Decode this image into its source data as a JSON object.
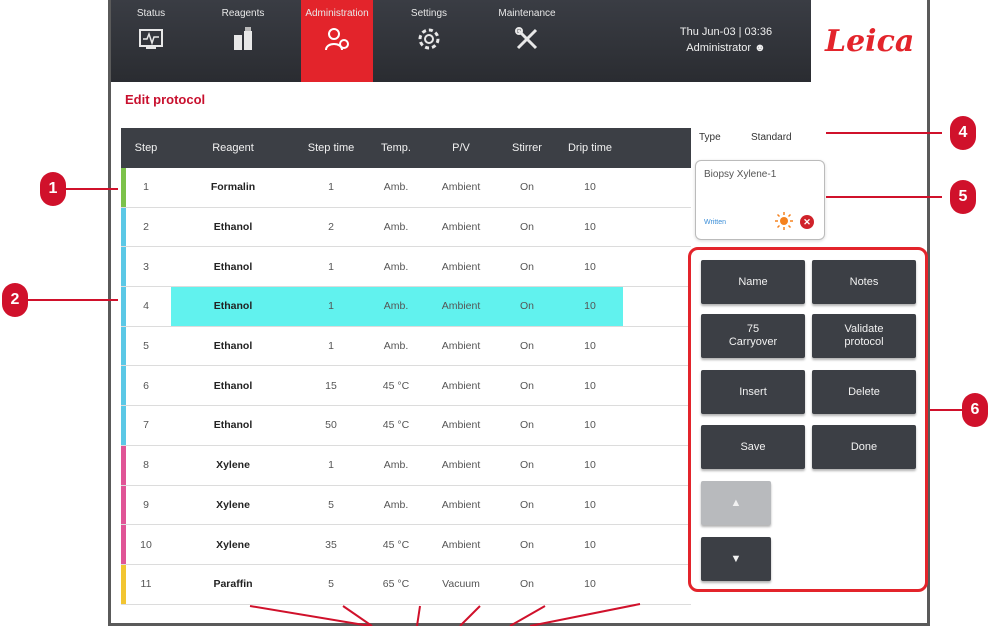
{
  "nav": {
    "tabs": [
      {
        "label": "Status",
        "icon": "status-monitor-icon"
      },
      {
        "label": "Reagents",
        "icon": "reagents-icon"
      },
      {
        "label": "Administration",
        "icon": "administration-icon"
      },
      {
        "label": "Settings",
        "icon": "settings-gear-icon"
      },
      {
        "label": "Maintenance",
        "icon": "maintenance-tools-icon"
      }
    ],
    "active_tab": "Administration",
    "datetime": "Thu Jun-03 | 03:36",
    "user": "Administrator",
    "logo": "Leica"
  },
  "page": {
    "title": "Edit protocol"
  },
  "table": {
    "headers": [
      "Step",
      "Reagent",
      "Step time",
      "Temp.",
      "P/V",
      "Stirrer",
      "Drip time"
    ],
    "rows": [
      {
        "step": "1",
        "reagent": "Formalin",
        "time": "1",
        "temp": "Amb.",
        "pv": "Ambient",
        "stirrer": "On",
        "drip": "10"
      },
      {
        "step": "2",
        "reagent": "Ethanol",
        "time": "2",
        "temp": "Amb.",
        "pv": "Ambient",
        "stirrer": "On",
        "drip": "10"
      },
      {
        "step": "3",
        "reagent": "Ethanol",
        "time": "1",
        "temp": "Amb.",
        "pv": "Ambient",
        "stirrer": "On",
        "drip": "10"
      },
      {
        "step": "4",
        "reagent": "Ethanol",
        "time": "1",
        "temp": "Amb.",
        "pv": "Ambient",
        "stirrer": "On",
        "drip": "10"
      },
      {
        "step": "5",
        "reagent": "Ethanol",
        "time": "1",
        "temp": "Amb.",
        "pv": "Ambient",
        "stirrer": "On",
        "drip": "10"
      },
      {
        "step": "6",
        "reagent": "Ethanol",
        "time": "15",
        "temp": "45 °C",
        "pv": "Ambient",
        "stirrer": "On",
        "drip": "10"
      },
      {
        "step": "7",
        "reagent": "Ethanol",
        "time": "50",
        "temp": "45 °C",
        "pv": "Ambient",
        "stirrer": "On",
        "drip": "10"
      },
      {
        "step": "8",
        "reagent": "Xylene",
        "time": "1",
        "temp": "Amb.",
        "pv": "Ambient",
        "stirrer": "On",
        "drip": "10"
      },
      {
        "step": "9",
        "reagent": "Xylene",
        "time": "5",
        "temp": "Amb.",
        "pv": "Ambient",
        "stirrer": "On",
        "drip": "10"
      },
      {
        "step": "10",
        "reagent": "Xylene",
        "time": "35",
        "temp": "45 °C",
        "pv": "Ambient",
        "stirrer": "On",
        "drip": "10"
      },
      {
        "step": "11",
        "reagent": "Paraffin",
        "time": "5",
        "temp": "65 °C",
        "pv": "Vacuum",
        "stirrer": "On",
        "drip": "10"
      }
    ],
    "selected_step": "4",
    "group_colors": {
      "Formalin": "#7cc24a",
      "Ethanol": "#5bc8e6",
      "Xylene": "#e05596",
      "Paraffin": "#f2c531"
    },
    "selected_color": "#61f2ee"
  },
  "side": {
    "type_label": "Type",
    "type_value": "Standard",
    "preview_name": "Biopsy Xylene-1",
    "preview_status": "Written"
  },
  "buttons": {
    "name": "Name",
    "notes": "Notes",
    "carryover_value": "75",
    "carryover_label": "Carryover",
    "validate_line1": "Validate",
    "validate_line2": "protocol",
    "insert": "Insert",
    "delete": "Delete",
    "save": "Save",
    "done": "Done"
  },
  "callouts": [
    "1",
    "2",
    "4",
    "5",
    "6"
  ],
  "colors": {
    "accent": "#e3242b",
    "callout": "#d0112b",
    "header_dark": "#3c3f45"
  }
}
